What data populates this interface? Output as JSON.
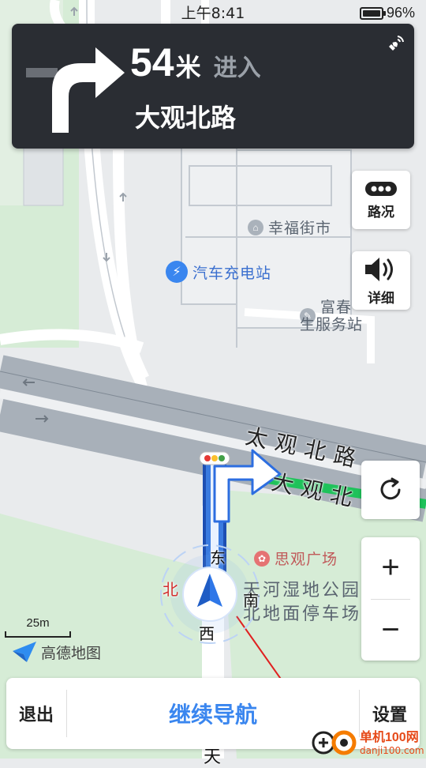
{
  "status_bar": {
    "time": "上午8:41",
    "battery": "96%"
  },
  "guidance": {
    "distance_value": "54",
    "distance_unit": "米",
    "action": "进入",
    "road": "大观北路"
  },
  "map": {
    "road_label_1": "太观北路",
    "road_label_2": "大观北",
    "poi_market": "幸福街市",
    "poi_charging": "汽车充电站",
    "poi_service_line1": "富春",
    "poi_service_line2": "生服务站",
    "poi_plaza": "思观广场",
    "poi_park_line1": "天河湿地公园",
    "poi_park_line2": "北地面停车场",
    "compass_east": "东",
    "compass_south": "南",
    "compass_west": "西",
    "compass_north": "北",
    "bottom_road_char": "天"
  },
  "buttons": {
    "traffic": "路况",
    "detail": "详细",
    "zoom_in": "+",
    "zoom_out": "−",
    "exit": "退出",
    "continue": "继续导航",
    "settings": "设置"
  },
  "scale": {
    "label": "25m"
  },
  "logo": {
    "text": "高德地图"
  },
  "watermark": {
    "title": "单机100网",
    "url": "danji100.com"
  },
  "colors": {
    "panel_bg": "#2a2d33",
    "route_blue": "#3a7be0",
    "route_green": "#1ec25a",
    "accent_blue": "#3a86ef"
  }
}
